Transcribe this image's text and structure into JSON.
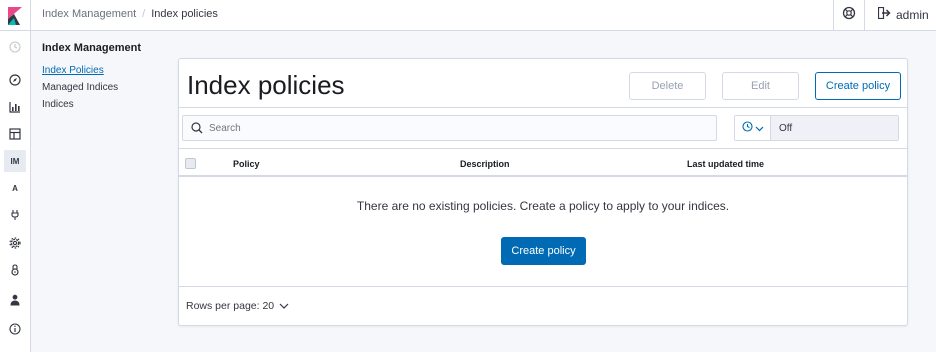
{
  "colors": {
    "accent": "#006bb4",
    "logo_pink": "#e8478b",
    "logo_teal": "#00bfb3",
    "logo_dark": "#343741"
  },
  "breadcrumbs": [
    "Index Management",
    "Index policies"
  ],
  "topbar": {
    "help_icon": "help-icon",
    "user_icon": "logout-icon",
    "user_label": "admin"
  },
  "sidenav": {
    "items": [
      {
        "icon": "recent-clock-icon"
      },
      {
        "icon": "discover-compass-icon"
      },
      {
        "icon": "visualize-chart-icon"
      },
      {
        "icon": "dashboard-icon"
      },
      {
        "label": "IM"
      },
      {
        "label": "A"
      },
      {
        "icon": "dev-tools-icon"
      },
      {
        "icon": "management-gear-icon"
      },
      {
        "icon": "security-lock-icon"
      },
      {
        "icon": "user-icon"
      },
      {
        "icon": "info-icon"
      }
    ]
  },
  "section": {
    "title": "Index Management"
  },
  "menu": [
    "Index Policies",
    "Managed Indices",
    "Indices"
  ],
  "main": {
    "title": "Index policies",
    "buttons": {
      "delete": "Delete",
      "edit": "Edit",
      "create": "Create policy"
    },
    "search": {
      "placeholder": "Search"
    },
    "refresh": {
      "value": "Off"
    },
    "columns": [
      "Policy",
      "Description",
      "Last updated time"
    ],
    "empty_message": "There are no existing policies. Create a policy to apply to your indices.",
    "empty_button": "Create policy",
    "pager": {
      "rows_per_page": "Rows per page: 20"
    }
  }
}
